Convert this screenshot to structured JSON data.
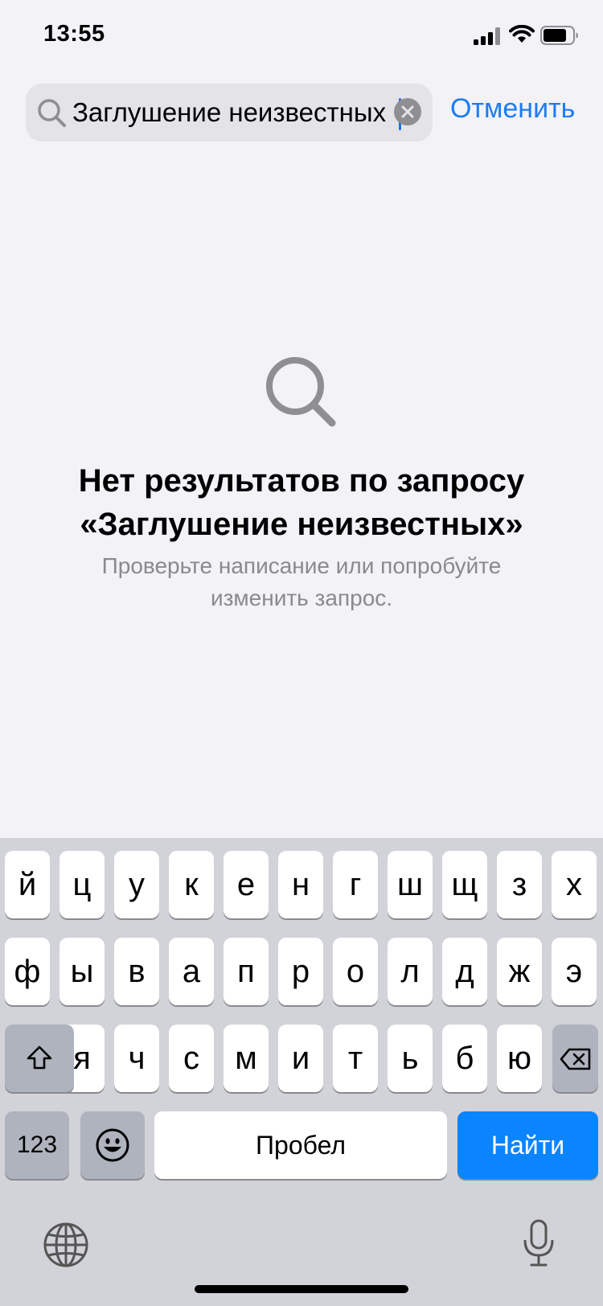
{
  "status_bar": {
    "time": "13:55"
  },
  "search": {
    "query": "Заглушение неизвестных",
    "cancel_label": "Отменить"
  },
  "empty_state": {
    "title_line1": "Нет результатов по запросу",
    "title_line2": "«Заглушение неизвестных»",
    "subtitle_line1": "Проверьте написание или попробуйте",
    "subtitle_line2": "изменить запрос."
  },
  "keyboard": {
    "row1": [
      "й",
      "ц",
      "у",
      "к",
      "е",
      "н",
      "г",
      "ш",
      "щ",
      "з",
      "х"
    ],
    "row2": [
      "ф",
      "ы",
      "в",
      "а",
      "п",
      "р",
      "о",
      "л",
      "д",
      "ж",
      "э"
    ],
    "row3": [
      "я",
      "ч",
      "с",
      "м",
      "и",
      "т",
      "ь",
      "б",
      "ю"
    ],
    "numbers_label": "123",
    "space_label": "Пробел",
    "return_label": "Найти"
  },
  "colors": {
    "accent": "#1c7cf4",
    "return_key": "#0a84ff"
  }
}
